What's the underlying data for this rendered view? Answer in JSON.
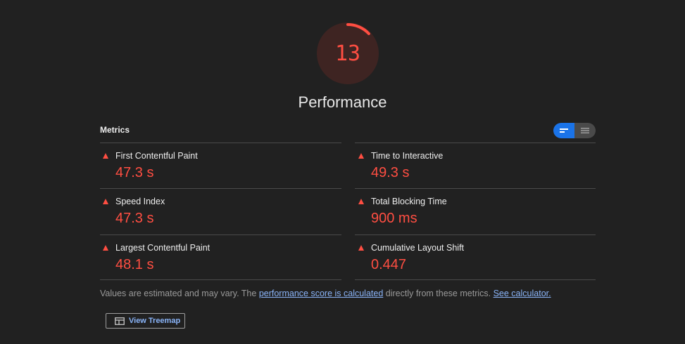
{
  "score": {
    "value": "13",
    "fraction": 0.13,
    "title": "Performance",
    "color": "#ff4e42",
    "track_color": "#3e2422"
  },
  "metrics": {
    "header": "Metrics",
    "toggle": {
      "left_icon": "expanded-view-icon",
      "right_icon": "list-view-icon",
      "selected": "left"
    },
    "items": [
      {
        "label": "First Contentful Paint",
        "value": "47.3 s",
        "status": "fail"
      },
      {
        "label": "Time to Interactive",
        "value": "49.3 s",
        "status": "fail"
      },
      {
        "label": "Speed Index",
        "value": "47.3 s",
        "status": "fail"
      },
      {
        "label": "Total Blocking Time",
        "value": "900 ms",
        "status": "fail"
      },
      {
        "label": "Largest Contentful Paint",
        "value": "48.1 s",
        "status": "fail"
      },
      {
        "label": "Cumulative Layout Shift",
        "value": "0.447",
        "status": "fail"
      }
    ]
  },
  "note": {
    "prefix": "Values are estimated and may vary. The ",
    "link1": "performance score is calculated",
    "middle": " directly from these metrics. ",
    "link2": "See calculator."
  },
  "treemap_button": {
    "label": "View Treemap",
    "icon": "treemap-icon"
  },
  "colors": {
    "fail": "#ff4e42",
    "accent": "#1a73e8",
    "link": "#8ab4f8",
    "background": "#212121"
  }
}
